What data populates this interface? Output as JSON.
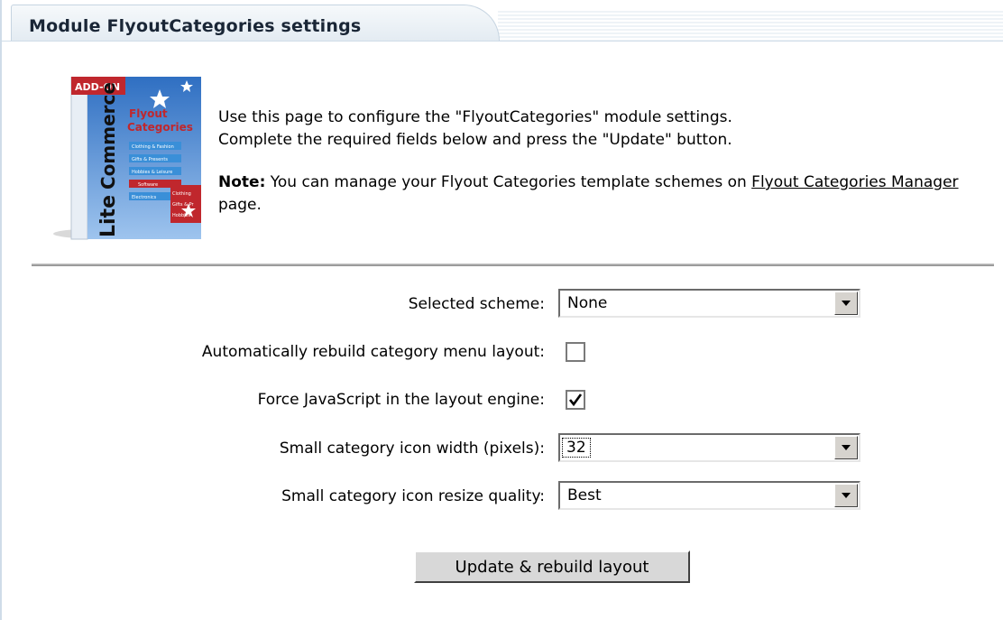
{
  "header": {
    "title": "Module FlyoutCategories settings"
  },
  "boxart": {
    "badge": "ADD-ON",
    "brand_top": "Lite",
    "brand_bottom": "Commerce",
    "product_line1": "Flyout",
    "product_line2": "Categories",
    "menu_items": [
      "Clothing & Fashion",
      "Gifts & Presents",
      "Hobbies & Leisure",
      "Software",
      "Electronics"
    ],
    "submenu_items": [
      "Clothing",
      "Gifts & Pr",
      "Hobbies"
    ]
  },
  "intro": {
    "line1": "Use this page to configure the \"FlyoutCategories\" module settings.",
    "line2": "Complete the required fields below and press the \"Update\" button.",
    "note_label": "Note:",
    "note_text": " You can manage your Flyout Categories template schemes on ",
    "note_link": "Flyout Categories Manager",
    "note_suffix": " page."
  },
  "form": {
    "scheme": {
      "label": "Selected scheme:",
      "value": "None"
    },
    "auto_rebuild": {
      "label": "Automatically rebuild category menu layout:",
      "checked": false
    },
    "force_js": {
      "label": "Force JavaScript in the layout engine:",
      "checked": true
    },
    "icon_width": {
      "label": "Small category icon width (pixels):",
      "value": "32"
    },
    "resize_quality": {
      "label": "Small category icon resize quality:",
      "value": "Best"
    }
  },
  "actions": {
    "submit_label": "Update & rebuild layout"
  },
  "colors": {
    "tab_bg": "#e3ebf2",
    "tab_border": "#c6d4e1",
    "button_face": "#d8d8d8"
  }
}
